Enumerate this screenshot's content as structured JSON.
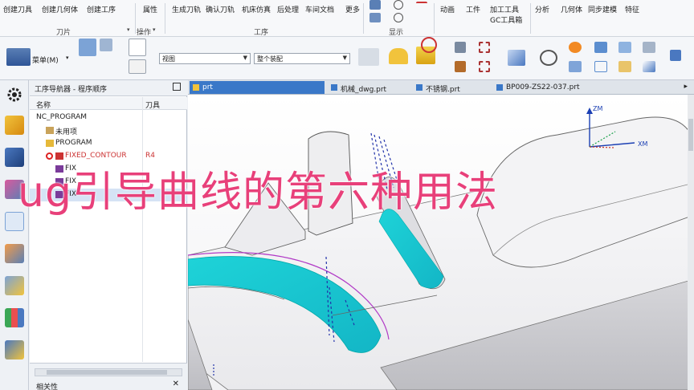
{
  "ribbon": {
    "top_items": [
      "创建刀具",
      "创建几何体",
      "创建工序",
      "属性",
      "生成刀轨",
      "确认刀轨",
      "机床仿真",
      "后处理",
      "车间文档",
      "更多",
      "动画",
      "工件",
      "加工工具",
      "分析",
      "几何体",
      "同步建模",
      "特征"
    ],
    "gc_toolbox": "GC工具箱",
    "groups": [
      "刀片",
      "操作",
      "工序",
      "显示"
    ],
    "menu_label": "菜单(M)",
    "view_filter": "视图",
    "assembly_filter": "整个装配"
  },
  "navigator": {
    "title": "工序导航器 - 程序顺序",
    "col_name": "名称",
    "col_tool": "刀具",
    "rows": [
      {
        "name": "NC_PROGRAM",
        "tool": ""
      },
      {
        "name": "未用项",
        "tool": ""
      },
      {
        "name": "PROGRAM",
        "tool": ""
      },
      {
        "name": "FIXED_CONTOUR",
        "tool": "R4"
      },
      {
        "name": "FIX",
        "tool": ""
      },
      {
        "name": "FIX",
        "tool": ""
      },
      {
        "name": "FIX",
        "tool": ""
      }
    ],
    "bottom_label": "相关性"
  },
  "tabs": [
    {
      "label": "prt",
      "active": true
    },
    {
      "label": "机械_dwg.prt",
      "active": false
    },
    {
      "label": "不锈钢.prt",
      "active": false
    },
    {
      "label": "BP009-ZS22-037.prt",
      "active": false
    }
  ],
  "overlay_title": "ug引导曲线的第六种用法",
  "axes": {
    "z": "ZM",
    "x": "XM"
  },
  "colors": {
    "accent": "#3a78c8",
    "title": "#e8407a",
    "toolpath": "#1ed3d8"
  }
}
